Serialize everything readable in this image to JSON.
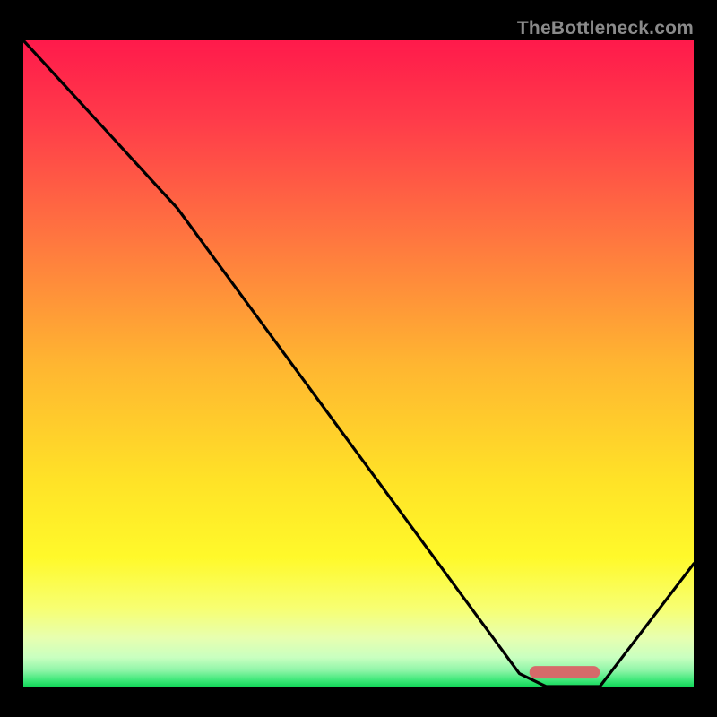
{
  "watermark": "TheBottleneck.com",
  "chart_data": {
    "type": "line",
    "title": "",
    "xlabel": "",
    "ylabel": "",
    "x_range": [
      0,
      100
    ],
    "y_range": [
      0,
      100
    ],
    "series": [
      {
        "name": "curve",
        "x": [
          0,
          23,
          74,
          78,
          86,
          100
        ],
        "y": [
          100,
          74,
          2,
          0,
          0,
          19
        ]
      }
    ],
    "marker": {
      "x_start": 75.5,
      "x_end": 86,
      "y": 2.2,
      "color": "#d66a6a"
    },
    "gradient_stops": [
      {
        "offset": 0.0,
        "color": "#ff1a4b"
      },
      {
        "offset": 0.12,
        "color": "#ff3a4a"
      },
      {
        "offset": 0.3,
        "color": "#ff7440"
      },
      {
        "offset": 0.5,
        "color": "#ffb531"
      },
      {
        "offset": 0.68,
        "color": "#ffe227"
      },
      {
        "offset": 0.8,
        "color": "#fff92a"
      },
      {
        "offset": 0.88,
        "color": "#f7ff73"
      },
      {
        "offset": 0.925,
        "color": "#e7ffb0"
      },
      {
        "offset": 0.955,
        "color": "#c9ffc0"
      },
      {
        "offset": 0.975,
        "color": "#8ff5a8"
      },
      {
        "offset": 0.99,
        "color": "#3fe87a"
      },
      {
        "offset": 1.0,
        "color": "#14d65a"
      }
    ]
  }
}
